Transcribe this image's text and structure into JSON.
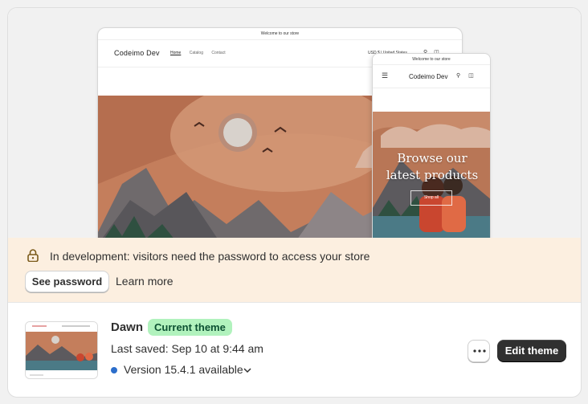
{
  "preview": {
    "announcement": "Welcome to our store",
    "store_name": "Codeimo Dev",
    "nav": [
      "Home",
      "Catalog",
      "Contact"
    ],
    "currency": "USD $ | United States",
    "mobile_banner_heading_line1": "Browse our",
    "mobile_banner_heading_line2": "latest products",
    "mobile_banner_button": "Shop all",
    "thumbnail_banner_text": "Browse our latest products"
  },
  "notice": {
    "icon": "lock-icon",
    "message": "In development: visitors need the password to access your store",
    "see_password_label": "See password",
    "learn_more_label": "Learn more",
    "background": "#fcefe0"
  },
  "theme": {
    "name": "Dawn",
    "badge": "Current theme",
    "badge_color": "#b1f2bd",
    "last_saved": "Last saved: Sep 10 at 9:44 am",
    "version": "Version 15.4.1 available",
    "version_dot_color": "#2c6ecb",
    "edit_label": "Edit theme"
  }
}
